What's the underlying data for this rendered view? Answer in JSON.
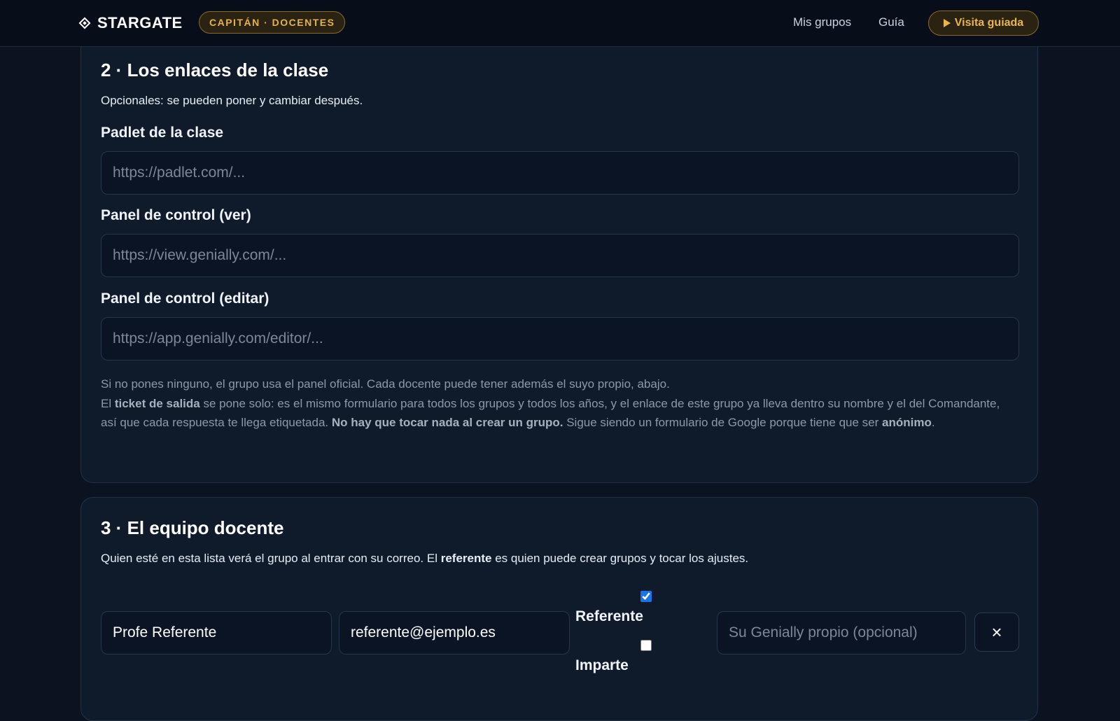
{
  "header": {
    "brand": "STARGATE",
    "role_badge": "CAPITÁN · DOCENTES",
    "nav": {
      "my_groups": "Mis grupos",
      "guide": "Guía"
    },
    "tour_button": "Visita guiada"
  },
  "links_section": {
    "title": "2 · Los enlaces de la clase",
    "subtitle": "Opcionales: se pueden poner y cambiar después.",
    "padlet": {
      "label": "Padlet de la clase",
      "placeholder": "https://padlet.com/...",
      "value": ""
    },
    "panel_view": {
      "label": "Panel de control (ver)",
      "placeholder": "https://view.genially.com/...",
      "value": ""
    },
    "panel_edit": {
      "label": "Panel de control (editar)",
      "placeholder": "https://app.genially.com/editor/...",
      "value": ""
    },
    "note": {
      "line1": "Si no pones ninguno, el grupo usa el panel oficial. Cada docente puede tener además el suyo propio, abajo.",
      "p2_a": "El ",
      "p2_bold1": "ticket de salida",
      "p2_b": " se pone solo: es el mismo formulario para todos los grupos y todos los años, y el enlace de este grupo ya lleva dentro su nombre y el del Comandante, así que cada respuesta te llega etiquetada. ",
      "p2_bold2": "No hay que tocar nada al crear un grupo.",
      "p2_c": " Sigue siendo un formulario de Google porque tiene que ser ",
      "p2_bold3": "anónimo",
      "p2_d": "."
    }
  },
  "team_section": {
    "title": "3 · El equipo docente",
    "lead_a": "Quien esté en esta lista verá el grupo al entrar con su correo. El ",
    "lead_bold": "referente",
    "lead_b": " es quien puede crear grupos y tocar los ajustes.",
    "member": {
      "name": "Profe Referente",
      "email": "referente@ejemplo.es",
      "referente_label": "Referente",
      "referente_checked": true,
      "imparte_label": "Imparte",
      "imparte_checked": false,
      "genially_placeholder": "Su Genially propio (opcional)",
      "remove_symbol": "×"
    }
  }
}
